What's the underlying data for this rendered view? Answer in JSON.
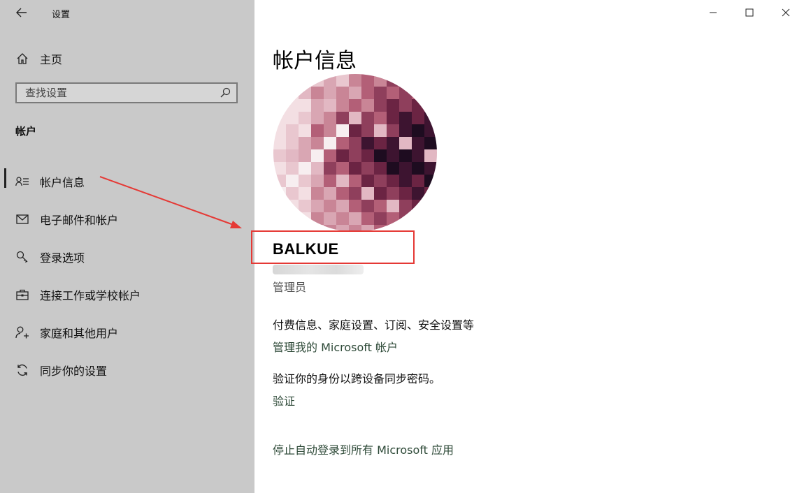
{
  "window": {
    "title": "设置",
    "controls": {
      "minimize": "minimize-icon",
      "maximize": "maximize-icon",
      "close": "close-icon"
    }
  },
  "sidebar": {
    "home_label": "主页",
    "search_placeholder": "查找设置",
    "section_title": "帐户",
    "items": [
      {
        "label": "帐户信息",
        "icon": "user-info-icon",
        "selected": true
      },
      {
        "label": "电子邮件和帐户",
        "icon": "mail-icon",
        "selected": false
      },
      {
        "label": "登录选项",
        "icon": "key-icon",
        "selected": false
      },
      {
        "label": "连接工作或学校帐户",
        "icon": "briefcase-icon",
        "selected": false
      },
      {
        "label": "家庭和其他用户",
        "icon": "person-add-icon",
        "selected": false
      },
      {
        "label": "同步你的设置",
        "icon": "sync-icon",
        "selected": false
      }
    ]
  },
  "main": {
    "page_title": "帐户信息",
    "user_name": "BALKUE",
    "role": "管理员",
    "billing_text": "付费信息、家庭设置、订阅、安全设置等",
    "manage_link": "管理我的 Microsoft 帐户",
    "verify_text": "验证你的身份以跨设备同步密码。",
    "verify_link": "验证",
    "stop_link": "停止自动登录到所有 Microsoft 应用"
  },
  "colors": {
    "sidebar_bg": "#c9c9c9",
    "link": "#2e4a38",
    "annotation": "#e53935"
  }
}
